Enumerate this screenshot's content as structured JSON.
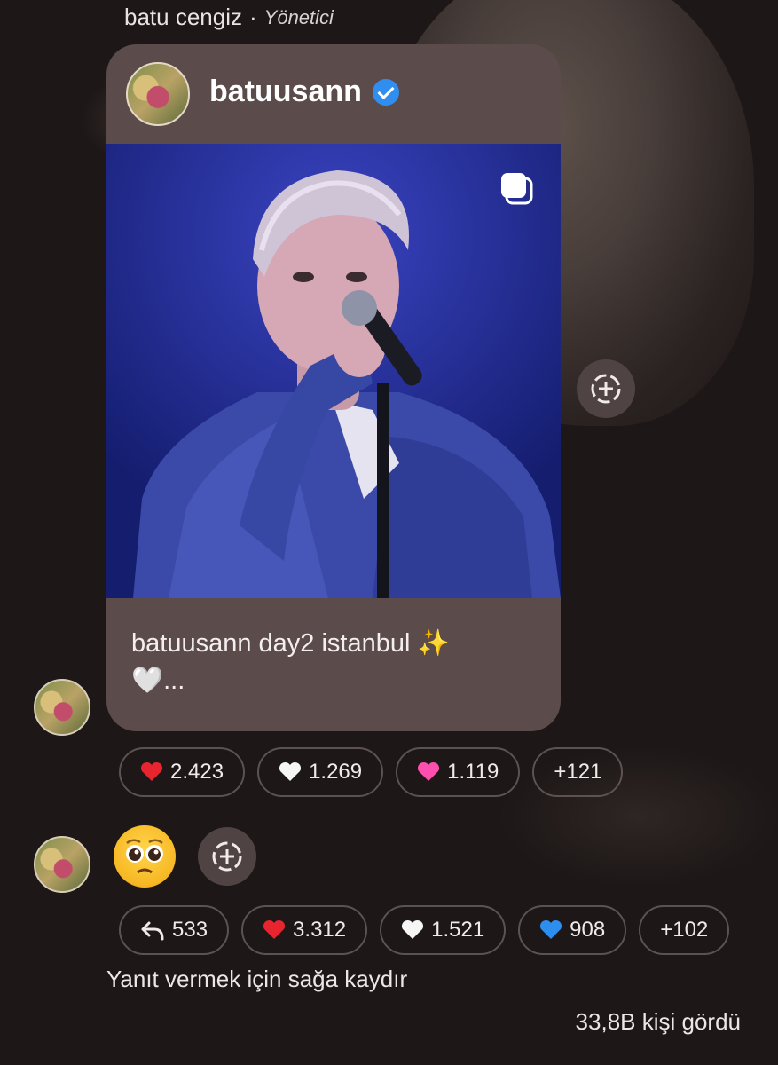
{
  "sender": {
    "name": "batu cengiz",
    "separator": "·",
    "role": "Yönetici"
  },
  "post": {
    "username": "batuusann",
    "caption_line1": "batuusann day2 istanbul ✨",
    "caption_line2": "🤍...",
    "colors": {
      "card": "#5b4b4b",
      "photo_bg": "#1c2696",
      "verified": "#2f8ef0"
    }
  },
  "reactions_post": [
    {
      "emoji": "red-heart",
      "count": "2.423"
    },
    {
      "emoji": "white-heart",
      "count": "1.269"
    },
    {
      "emoji": "pink-heart",
      "count": "1.119"
    },
    {
      "emoji": "",
      "count": "+121"
    }
  ],
  "reactions_emoji": [
    {
      "emoji": "reply-icon",
      "count": "533"
    },
    {
      "emoji": "red-heart",
      "count": "3.312"
    },
    {
      "emoji": "white-heart",
      "count": "1.521"
    },
    {
      "emoji": "blue-heart",
      "count": "908"
    },
    {
      "emoji": "",
      "count": "+102"
    }
  ],
  "hint": "Yanıt vermek için sağa kaydır",
  "seen": "33,8B kişi gördü",
  "background": "#1d1717"
}
